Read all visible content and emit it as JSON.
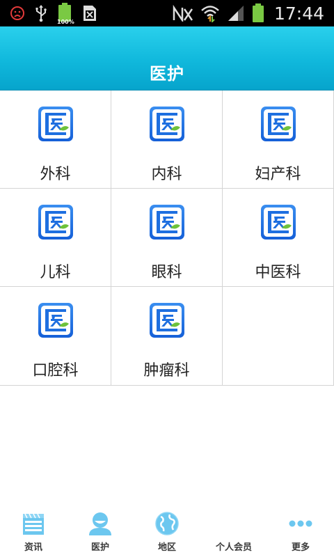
{
  "status_bar": {
    "time": "17:44",
    "battery_left_pct": "100%",
    "icons": [
      "sad-face-icon",
      "usb-icon",
      "battery-full-icon",
      "sim-card-icon",
      "no-signal-icon",
      "wifi-icon",
      "cell-signal-icon",
      "battery-icon"
    ],
    "accent_battery": "#7ac943"
  },
  "header": {
    "title": "医护",
    "color_top": "#2ad0ec",
    "color_bottom": "#06a4cc"
  },
  "departments": [
    {
      "label": "外科",
      "icon": "hospital-icon"
    },
    {
      "label": "内科",
      "icon": "hospital-icon"
    },
    {
      "label": "妇产科",
      "icon": "hospital-icon"
    },
    {
      "label": "儿科",
      "icon": "hospital-icon"
    },
    {
      "label": "眼科",
      "icon": "hospital-icon"
    },
    {
      "label": "中医科",
      "icon": "hospital-icon"
    },
    {
      "label": "口腔科",
      "icon": "hospital-icon"
    },
    {
      "label": "肿瘤科",
      "icon": "hospital-icon"
    }
  ],
  "bottom_nav": {
    "items": [
      {
        "label": "资讯",
        "icon": "news-icon"
      },
      {
        "label": "医护",
        "icon": "person-icon"
      },
      {
        "label": "地区",
        "icon": "globe-icon"
      },
      {
        "label": "个人会员",
        "icon": "member-icon"
      },
      {
        "label": "更多",
        "icon": "more-dots-icon"
      }
    ],
    "icon_color": "#6cc7ef"
  }
}
